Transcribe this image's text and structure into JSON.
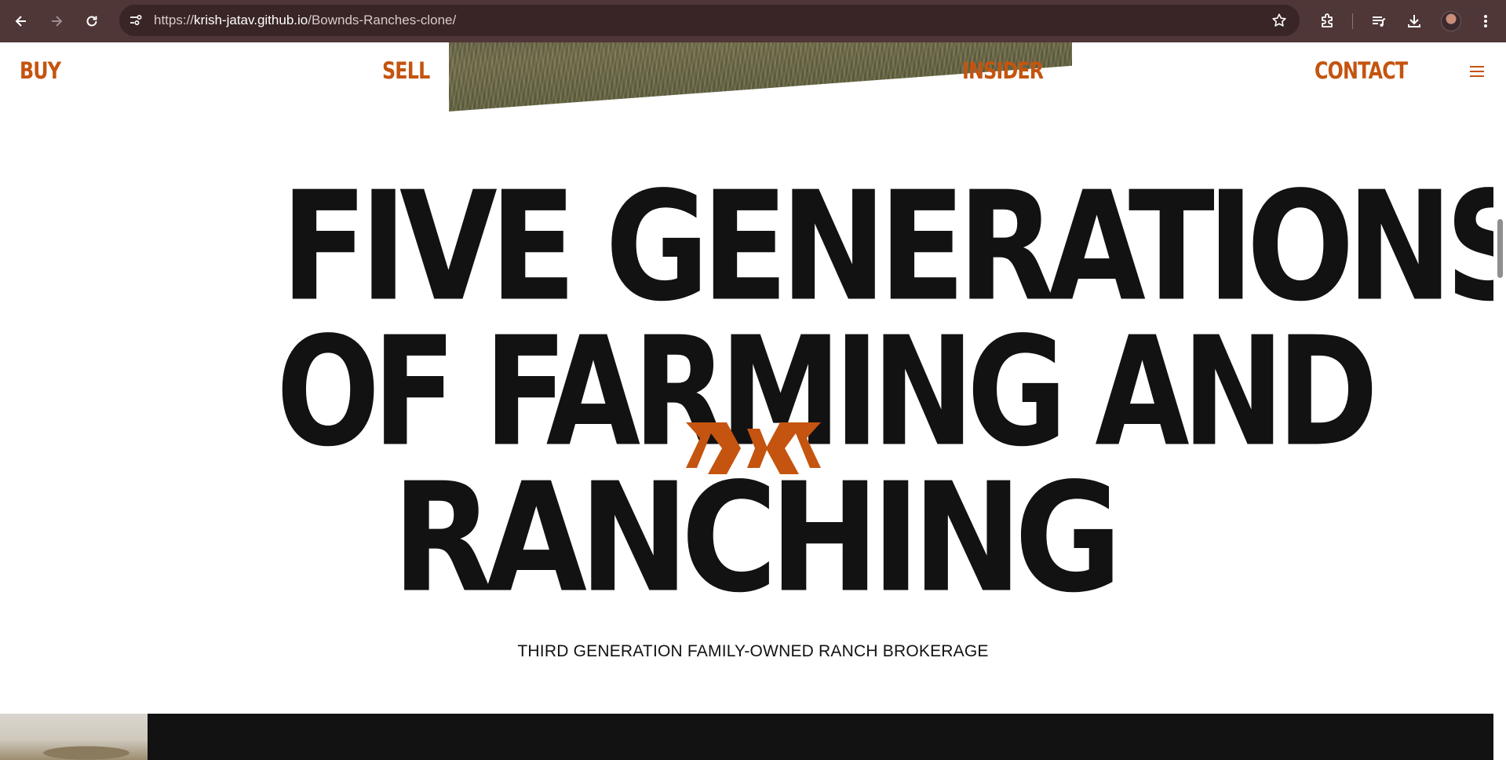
{
  "browser": {
    "url_scheme": "https://",
    "url_host": "krish-jatav.github.io",
    "url_path": "/Bownds-Ranches-clone/",
    "icons": [
      "back-icon",
      "forward-icon",
      "reload-icon",
      "site-info-icon",
      "star-icon",
      "extensions-icon",
      "media-icon",
      "download-icon",
      "avatar",
      "more-icon"
    ]
  },
  "nav": {
    "buy": "BUY",
    "sell": "SELL",
    "insider": "INSIDER",
    "contact": "CONTACT",
    "menu_icon": "hamburger-icon"
  },
  "hero": {
    "line1": "FIVE GENERATIONS",
    "line2": "OF FARMING AND",
    "line3": "RANCHING",
    "subtitle": "THIRD GENERATION FAMILY-OWNED RANCH BROKERAGE",
    "emblem_icon": "bownds-logo-icon"
  },
  "colors": {
    "accent": "#c4540f",
    "text": "#121212",
    "chrome": "#4f3637",
    "omnibox": "#392526"
  }
}
